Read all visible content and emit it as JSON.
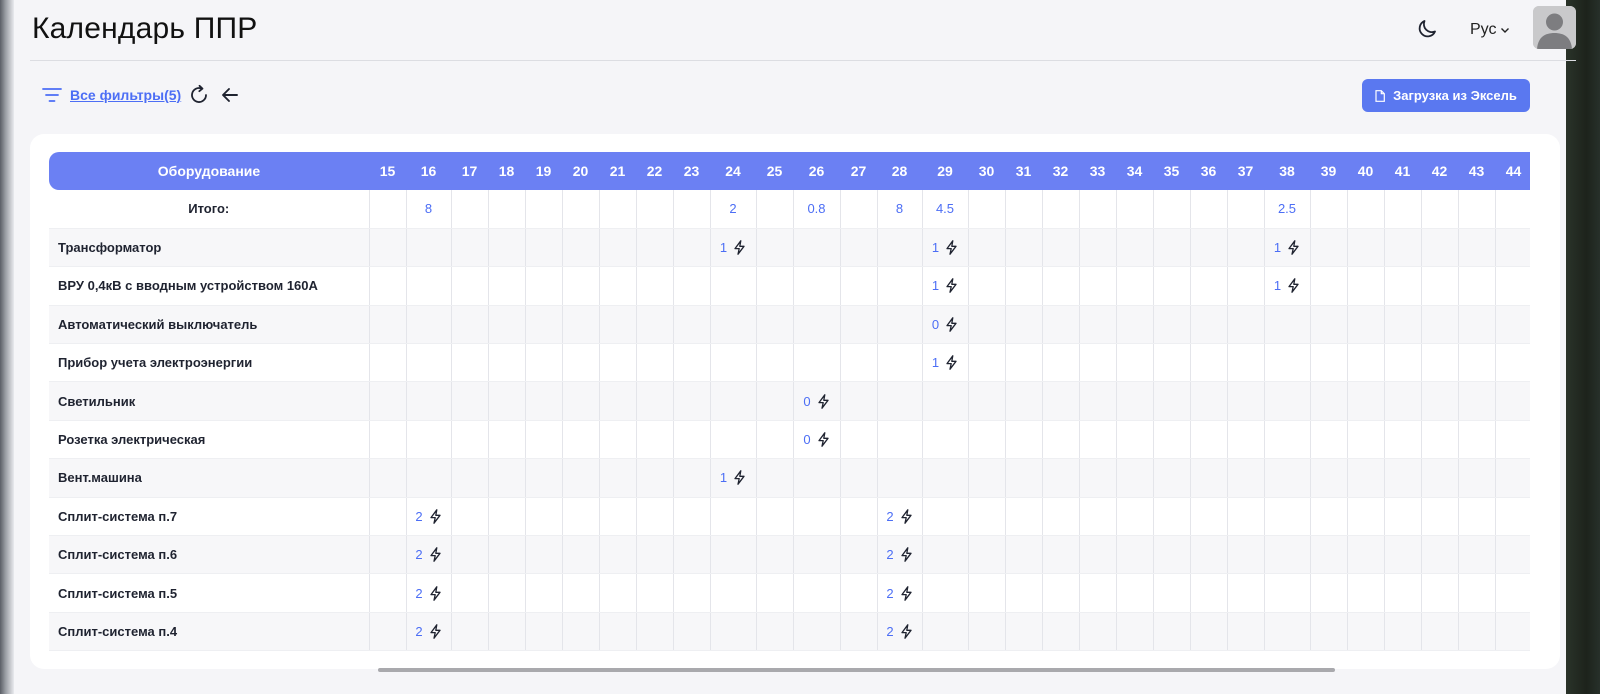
{
  "header": {
    "title": "Календарь ППР",
    "language": "Рус",
    "icons": {
      "theme": "moon-icon",
      "language_chevron": "chevron-down-icon",
      "avatar": "user-avatar"
    }
  },
  "toolbar": {
    "filters_label": "Все фильтры(5)",
    "excel_button_label": "Загрузка из Эксель",
    "icons": {
      "filter": "filter-icon",
      "refresh": "refresh-icon",
      "back": "arrow-left-icon",
      "excel": "file-icon"
    }
  },
  "colors": {
    "accent": "#5a78f0",
    "header_row": "#6b80f3",
    "value_text": "#4c6ef5"
  },
  "table": {
    "equipment_header": "Оборудование",
    "weeks": [
      "15",
      "16",
      "17",
      "18",
      "19",
      "20",
      "21",
      "22",
      "23",
      "24",
      "25",
      "26",
      "27",
      "28",
      "29",
      "30",
      "31",
      "32",
      "33",
      "34",
      "35",
      "36",
      "37",
      "38",
      "39",
      "40",
      "41",
      "42",
      "43",
      "44"
    ],
    "total_label": "Итого:",
    "totals": {
      "16": "8",
      "24": "2",
      "26": "0.8",
      "28": "8",
      "29": "4.5",
      "38": "2.5"
    },
    "rows": [
      {
        "name": "Трансформатор",
        "cells": {
          "24": "1",
          "29": "1",
          "38": "1"
        }
      },
      {
        "name": "ВРУ 0,4кВ с вводным устройством 160А",
        "cells": {
          "29": "1",
          "38": "1"
        }
      },
      {
        "name": "Автоматический выключатель",
        "cells": {
          "29": "0"
        }
      },
      {
        "name": "Прибор учета электроэнергии",
        "cells": {
          "29": "1"
        }
      },
      {
        "name": "Светильник",
        "cells": {
          "26": "0"
        }
      },
      {
        "name": "Розетка электрическая",
        "cells": {
          "26": "0"
        }
      },
      {
        "name": "Вент.машина",
        "cells": {
          "24": "1"
        }
      },
      {
        "name": "Сплит-система п.7",
        "cells": {
          "16": "2",
          "28": "2"
        }
      },
      {
        "name": "Сплит-система п.6",
        "cells": {
          "16": "2",
          "28": "2"
        }
      },
      {
        "name": "Сплит-система п.5",
        "cells": {
          "16": "2",
          "28": "2"
        }
      },
      {
        "name": "Сплит-система п.4",
        "cells": {
          "16": "2",
          "28": "2"
        }
      }
    ]
  }
}
